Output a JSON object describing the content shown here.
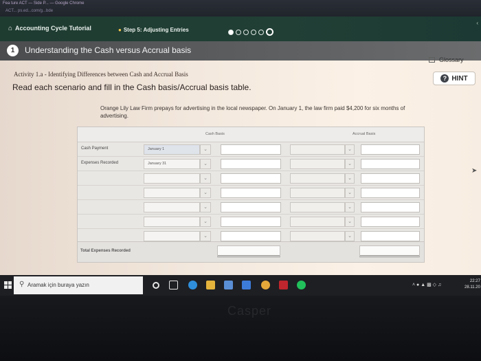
{
  "browser": {
    "tab_text": "Fea ture ACT — Side P... — Google Chrome",
    "url_text": "ACT... ps.ed...com/g...bde"
  },
  "header": {
    "tutorial_label": "Accounting Cycle Tutorial",
    "step_label": "Step 5: Adjusting Entries",
    "progress": {
      "total_steps": 6,
      "current_step": 6
    }
  },
  "title_bar": {
    "number": "1",
    "title": "Understanding the Cash versus Accrual basis"
  },
  "toolbar": {
    "glossary_label": "Glossary",
    "hint_label": "HINT"
  },
  "activity": {
    "heading": "Activity 1.a - Identifying Differences between Cash and Accrual Basis",
    "instruction": "Read each scenario and fill in the Cash basis/Accrual basis table.",
    "scenario": "Orange Lily Law Firm prepays for advertising in the local newspaper. On January 1, the law firm paid $4,200 for six months of advertising."
  },
  "table": {
    "columns": [
      "Cash Basis",
      "Accrual Basis"
    ],
    "rows": [
      {
        "label": "Cash Payment",
        "cash_date": "January 1",
        "cash_amount": "",
        "accrual_date": "",
        "accrual_amount": ""
      },
      {
        "label": "Expenses Recorded",
        "cash_date": "January 31",
        "cash_amount": "",
        "accrual_date": "",
        "accrual_amount": ""
      },
      {
        "label": "",
        "cash_date": "",
        "cash_amount": "",
        "accrual_date": "",
        "accrual_amount": ""
      },
      {
        "label": "",
        "cash_date": "",
        "cash_amount": "",
        "accrual_date": "",
        "accrual_amount": ""
      },
      {
        "label": "",
        "cash_date": "",
        "cash_amount": "",
        "accrual_date": "",
        "accrual_amount": ""
      },
      {
        "label": "",
        "cash_date": "",
        "cash_amount": "",
        "accrual_date": "",
        "accrual_amount": ""
      },
      {
        "label": "",
        "cash_date": "",
        "cash_amount": "",
        "accrual_date": "",
        "accrual_amount": ""
      }
    ],
    "total_label": "Total Expenses Recorded",
    "total_cash": "",
    "total_accrual": ""
  },
  "taskbar": {
    "search_placeholder": "Aramak için buraya yazın",
    "time": "22:27",
    "date": "28.11.20",
    "apps": [
      "cortana-icon",
      "task-view-icon",
      "edge-icon",
      "file-explorer-icon",
      "store-icon",
      "photos-icon",
      "chrome-icon",
      "netflix-icon",
      "spotify-icon"
    ]
  },
  "colors": {
    "header_green": "#1f3c31",
    "title_bar_gray": "#5b5d5f",
    "content_paper": "#f3e8dd"
  },
  "brand": "Casper"
}
